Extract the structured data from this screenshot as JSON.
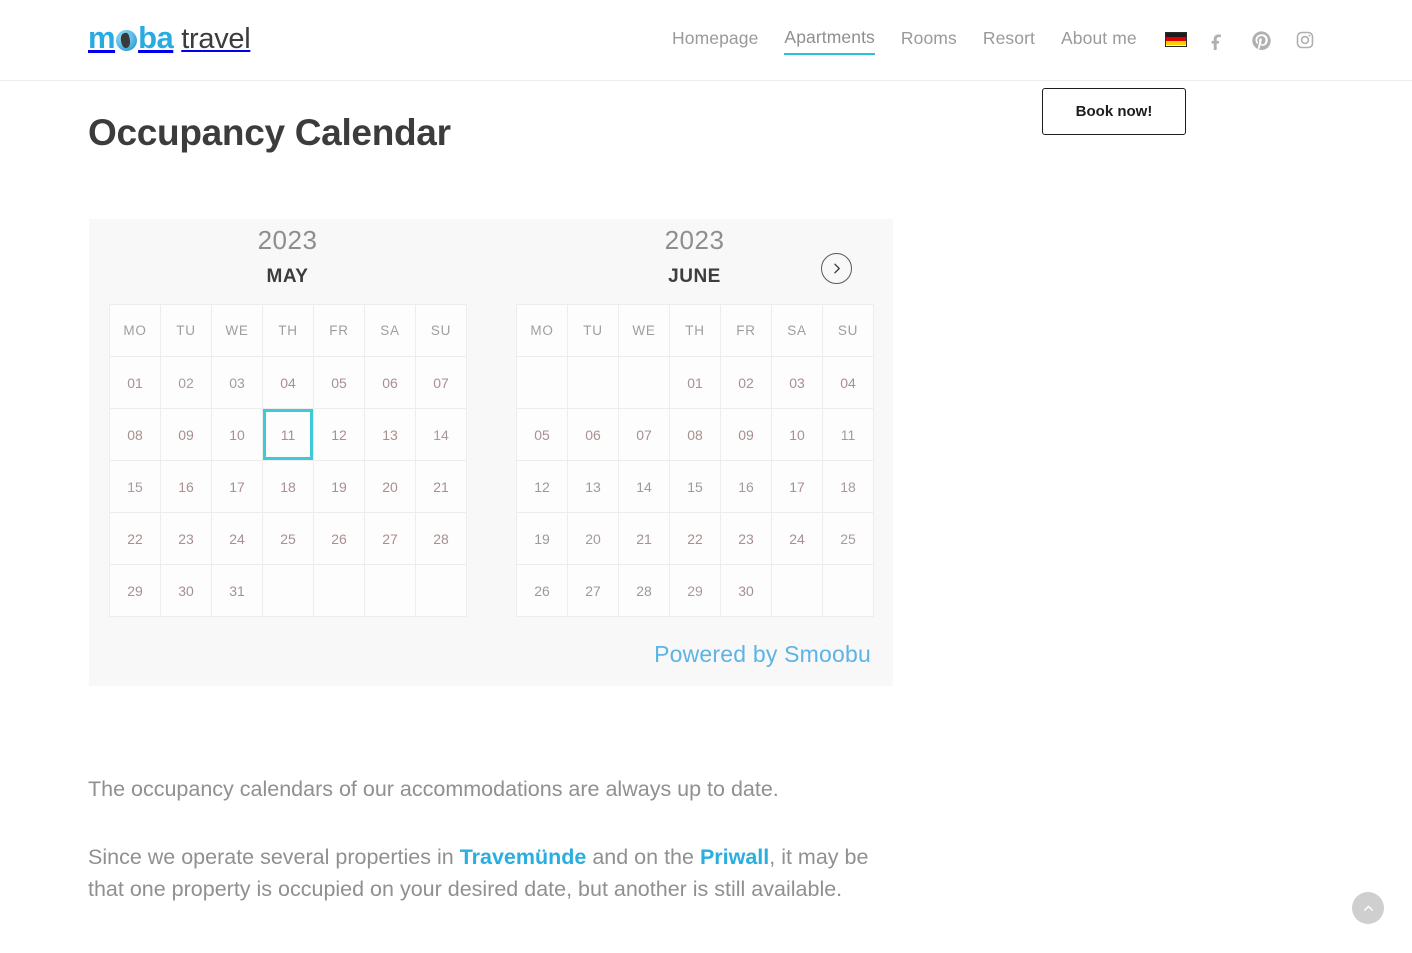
{
  "header": {
    "logo": {
      "part1": "m",
      "globe": "globe-icon",
      "part2": "ba",
      "part3": "travel"
    },
    "nav": [
      {
        "label": "Homepage",
        "active": false
      },
      {
        "label": "Apartments",
        "active": true
      },
      {
        "label": "Rooms",
        "active": false
      },
      {
        "label": "Resort",
        "active": false
      },
      {
        "label": "About me",
        "active": false
      }
    ],
    "language_flag": "german-flag-icon",
    "socials": [
      "facebook-icon",
      "pinterest-icon",
      "instagram-icon"
    ]
  },
  "book_button": {
    "label": "Book now!"
  },
  "page_title": "Occupancy Calendar",
  "calendar": {
    "weekdays": [
      "MO",
      "TU",
      "WE",
      "TH",
      "FR",
      "SA",
      "SU"
    ],
    "next_button": "chevron-right-icon",
    "powered_by": "Powered by Smoobu",
    "colors": {
      "booked": "#fabcbc",
      "free": "#fdfdfd",
      "selected_border": "#3fc8d8",
      "panel_bg": "#f8f8f8",
      "link": "#5eb3e4"
    },
    "months": [
      {
        "year": "2023",
        "name": "MAY",
        "weeks": [
          [
            {
              "day": "01",
              "state": "full"
            },
            {
              "day": "02",
              "state": "half-start"
            },
            {
              "day": "03",
              "state": "half-end"
            },
            {
              "day": "04",
              "state": "full"
            },
            {
              "day": "05",
              "state": "full"
            },
            {
              "day": "06",
              "state": "full"
            },
            {
              "day": "07",
              "state": "full"
            }
          ],
          [
            {
              "day": "08",
              "state": "full"
            },
            {
              "day": "09",
              "state": "full"
            },
            {
              "day": "10",
              "state": "full"
            },
            {
              "day": "11",
              "state": "full",
              "selected": true
            },
            {
              "day": "12",
              "state": "full"
            },
            {
              "day": "13",
              "state": "full"
            },
            {
              "day": "14",
              "state": "half-start"
            }
          ],
          [
            {
              "day": "15",
              "state": "half-end"
            },
            {
              "day": "16",
              "state": "full"
            },
            {
              "day": "17",
              "state": "full"
            },
            {
              "day": "18",
              "state": "full"
            },
            {
              "day": "19",
              "state": "full"
            },
            {
              "day": "20",
              "state": "full"
            },
            {
              "day": "21",
              "state": "full"
            }
          ],
          [
            {
              "day": "22",
              "state": "full"
            },
            {
              "day": "23",
              "state": "full"
            },
            {
              "day": "24",
              "state": "full"
            },
            {
              "day": "25",
              "state": "full"
            },
            {
              "day": "26",
              "state": "full"
            },
            {
              "day": "27",
              "state": "full"
            },
            {
              "day": "28",
              "state": "full"
            }
          ],
          [
            {
              "day": "29",
              "state": "full"
            },
            {
              "day": "30",
              "state": "full"
            },
            {
              "day": "31",
              "state": "full"
            },
            {
              "day": "",
              "state": "empty"
            },
            {
              "day": "",
              "state": "empty"
            },
            {
              "day": "",
              "state": "empty"
            },
            {
              "day": "",
              "state": "empty"
            }
          ]
        ]
      },
      {
        "year": "2023",
        "name": "JUNE",
        "weeks": [
          [
            {
              "day": "",
              "state": "empty"
            },
            {
              "day": "",
              "state": "empty"
            },
            {
              "day": "",
              "state": "empty"
            },
            {
              "day": "01",
              "state": "full"
            },
            {
              "day": "02",
              "state": "full"
            },
            {
              "day": "03",
              "state": "full"
            },
            {
              "day": "04",
              "state": "full"
            }
          ],
          [
            {
              "day": "05",
              "state": "full"
            },
            {
              "day": "06",
              "state": "full"
            },
            {
              "day": "07",
              "state": "full"
            },
            {
              "day": "08",
              "state": "full"
            },
            {
              "day": "09",
              "state": "full"
            },
            {
              "day": "10",
              "state": "full"
            },
            {
              "day": "11",
              "state": "half-start"
            }
          ],
          [
            {
              "day": "12",
              "state": "free"
            },
            {
              "day": "13",
              "state": "free"
            },
            {
              "day": "14",
              "state": "free"
            },
            {
              "day": "15",
              "state": "free"
            },
            {
              "day": "16",
              "state": "half-end"
            },
            {
              "day": "17",
              "state": "full"
            },
            {
              "day": "18",
              "state": "half-start"
            }
          ],
          [
            {
              "day": "19",
              "state": "free"
            },
            {
              "day": "20",
              "state": "half-end"
            },
            {
              "day": "21",
              "state": "full"
            },
            {
              "day": "22",
              "state": "full"
            },
            {
              "day": "23",
              "state": "full"
            },
            {
              "day": "24",
              "state": "full"
            },
            {
              "day": "25",
              "state": "half-start"
            }
          ],
          [
            {
              "day": "26",
              "state": "free"
            },
            {
              "day": "27",
              "state": "free"
            },
            {
              "day": "28",
              "state": "free"
            },
            {
              "day": "29",
              "state": "half-end"
            },
            {
              "day": "30",
              "state": "full"
            },
            {
              "day": "",
              "state": "empty"
            },
            {
              "day": "",
              "state": "empty"
            }
          ]
        ]
      }
    ]
  },
  "copy": {
    "paragraph1": "The occupancy calendars of our accommodations are always up to date.",
    "p2_a": "Since we operate several properties in ",
    "p2_link1": "Travemünde",
    "p2_b": " and on the ",
    "p2_link2": "Priwall",
    "p2_c": ", it may be that one property is occupied on your desired date, but another is still available."
  },
  "scroll_top": "chevron-up-icon"
}
